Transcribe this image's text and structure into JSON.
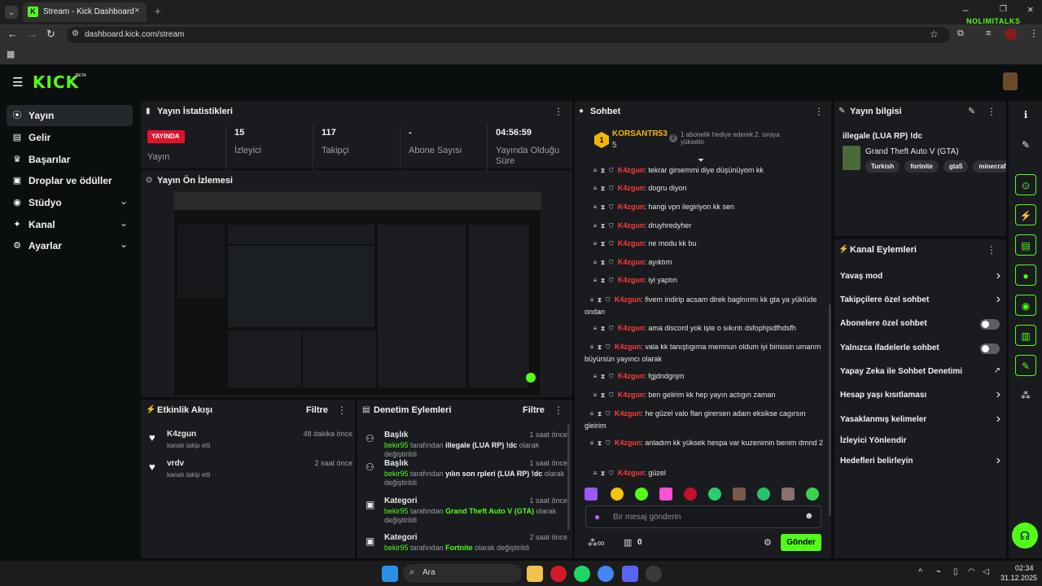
{
  "browser": {
    "tab_title": "Stream - Kick Dashboard",
    "url": "dashboard.kick.com/stream",
    "watermark": "NOLIMITALKS"
  },
  "brand": {
    "logo": "KICK",
    "beta": "BETA",
    "accent": "#53fc18"
  },
  "sidebar": {
    "items": [
      {
        "label": "Yayın",
        "icon": "broadcast-icon",
        "active": true
      },
      {
        "label": "Gelir",
        "icon": "revenue-icon"
      },
      {
        "label": "Başarılar",
        "icon": "trophy-icon"
      },
      {
        "label": "Droplar ve ödüller",
        "icon": "gift-icon"
      },
      {
        "label": "Stüdyo",
        "icon": "studio-icon",
        "expand": true
      },
      {
        "label": "Kanal",
        "icon": "channel-icon",
        "expand": true
      },
      {
        "label": "Ayarlar",
        "icon": "gear-icon",
        "expand": true
      }
    ]
  },
  "stats": {
    "title": "Yayın İstatistikleri",
    "live_badge": "YAYINDA",
    "live_label": "Yayın",
    "cells": [
      {
        "value": "15",
        "label": "İzleyici"
      },
      {
        "value": "117",
        "label": "Takipçi"
      },
      {
        "value": "-",
        "label": "Abone Sayısı"
      },
      {
        "value": "04:56:59",
        "label": "Yayında Olduğu Süre"
      }
    ]
  },
  "preview": {
    "title": "Yayın Ön İzlemesi"
  },
  "activity": {
    "title": "Etkinlik Akışı",
    "filter": "Filtre",
    "events": [
      {
        "name": "K4zgun",
        "desc": "kanalı takip etti",
        "time": "48 dakika önce"
      },
      {
        "name": "vrdv",
        "desc": "kanalı takip etti",
        "time": "2 saat önce"
      }
    ]
  },
  "moderation": {
    "title": "Denetim Eylemleri",
    "filter": "Filtre",
    "rows": [
      {
        "title": "Başlık",
        "time": "1 saat önce",
        "user": "bekir95",
        "mid": "tarafından",
        "value": "illegale (LUA RP) !dc",
        "tail": "olarak değiştirildi",
        "icon": "person-edit-icon"
      },
      {
        "title": "Başlık",
        "time": "1 saat önce",
        "user": "bekir95",
        "mid": "tarafından",
        "value": "yılın son rpleri (LUA RP) !dc",
        "tail": "olarak değiştirildi",
        "icon": "person-edit-icon"
      },
      {
        "title": "Kategori",
        "time": "1 saat önce",
        "user": "bekir95",
        "mid": "tarafından",
        "value": "Grand Theft Auto V (GTA)",
        "tail": "olarak değiştirildi",
        "icon": "category-icon"
      },
      {
        "title": "Kategori",
        "time": "2 saat önce",
        "user": "bekir95",
        "mid": "tarafından",
        "value": "Fortnite",
        "tail": "olarak değiştirildi",
        "icon": "category-icon"
      }
    ]
  },
  "chat": {
    "title": "Sohbet",
    "pinned_user": "KORSANTR53",
    "pinned_count": "5",
    "pinned_rank": "1",
    "gift_text": "1 abonelik hediye ederek 2. sıraya yükselin",
    "gift_rank": "2",
    "username": "K4zgun",
    "messages": [
      "tekrar girsemmi diye düşünüyom kk",
      "dogru diyon",
      "hangi vpn ilegiriyon kk sen",
      "druyhredyher",
      "ne modu kk bu",
      "ayıktım",
      "iyi yaptın",
      "fivem indirip acsam direk baglnırmı kk gta ya yüklüde ondan",
      "ama discord yok işte o sıkıntı dsfophjsdfhdsfh",
      "vala kk tanıştıgıma memnun oldum iyi birisisin umarım büyürsün yayıncı olarak",
      "fgjdndgnjm",
      "ben gelirim kk hep yayın actıgın zaman",
      "he güzel valo flan girersen adam eksikse cagırsın gleirim",
      "anladım kk yüksek hespa var kuzenimin benim dmnd 2",
      "güzel"
    ],
    "input_placeholder": "Bir mesaj gönderin",
    "points": "0",
    "send": "Gönder"
  },
  "stream_info": {
    "title": "Yayın bilgisi",
    "stream_title": "illegale (LUA RP) !dc",
    "category": "Grand Theft Auto V (GTA)",
    "tags": [
      "Turkish",
      "fortnite",
      "gta5",
      "minecraf"
    ]
  },
  "channel_actions": {
    "title": "Kanal Eylemleri",
    "rows": [
      {
        "label": "Yavaş mod",
        "ctrl": "chevron"
      },
      {
        "label": "Takipçilere özel sohbet",
        "ctrl": "chevron"
      },
      {
        "label": "Abonelere özel sohbet",
        "ctrl": "toggle"
      },
      {
        "label": "Yalnızca ifadelerle sohbet",
        "ctrl": "toggle"
      },
      {
        "label": "Yapay Zeka ile Sohbet Denetimi",
        "ctrl": "external"
      },
      {
        "label": "Hesap yaşı kısıtlaması",
        "ctrl": "chevron"
      },
      {
        "label": "Yasaklanmış kelimeler",
        "ctrl": "chevron"
      },
      {
        "label": "İzleyici Yönlendir",
        "ctrl": "none"
      },
      {
        "label": "Hedefleri belirleyin",
        "ctrl": "chevron"
      }
    ]
  },
  "taskbar": {
    "search": "Ara",
    "time": "02:34",
    "date": "31.12.2025"
  }
}
